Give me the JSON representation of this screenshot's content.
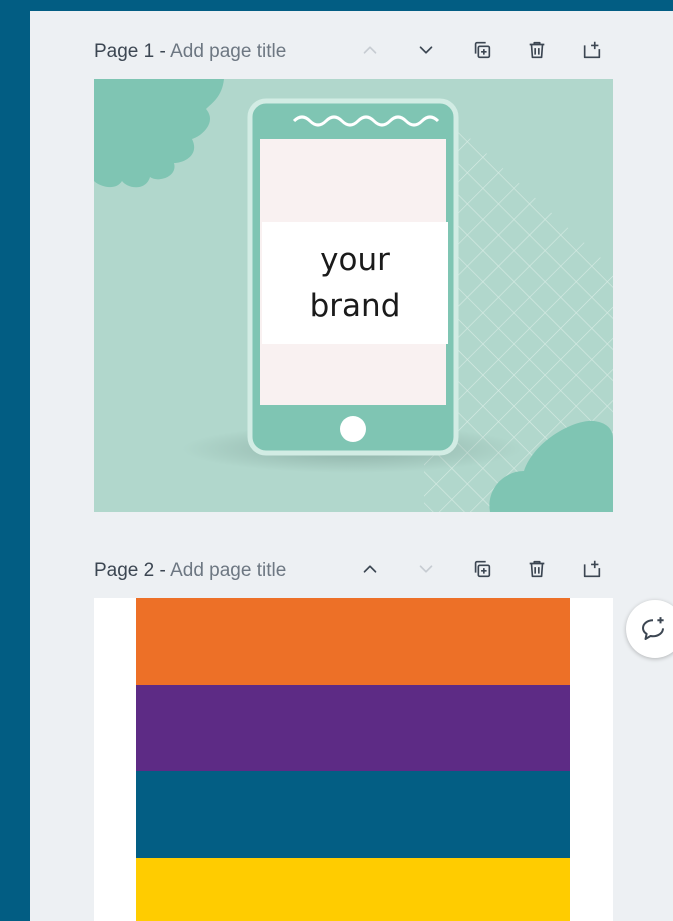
{
  "pages": [
    {
      "label": "Page 1",
      "separator": " - ",
      "title_placeholder": "Add page title",
      "design_text_line1": "your",
      "design_text_line2": "brand"
    },
    {
      "label": "Page 2",
      "separator": " - ",
      "title_placeholder": "Add page title"
    }
  ],
  "page2_stripes": [
    "#ed7027",
    "#5d2b85",
    "#035e84",
    "#ffcc00"
  ],
  "toolbar_icons": [
    "chevron-up-icon",
    "chevron-down-icon",
    "duplicate-icon",
    "trash-icon",
    "add-page-icon"
  ],
  "colors": {
    "background": "#025d83",
    "editor": "#edf0f3",
    "mint_bg": "#b1d7cc",
    "mint_dark": "#7fc5b3"
  }
}
